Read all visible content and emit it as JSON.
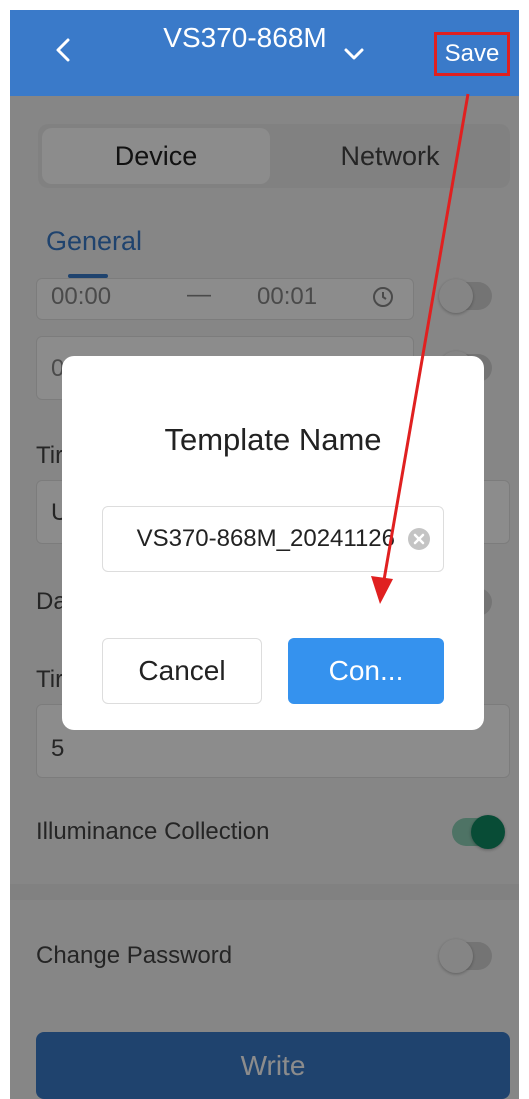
{
  "header": {
    "title": "VS370-868M",
    "save_label": "Save"
  },
  "tabs": [
    {
      "label": "Device"
    },
    {
      "label": "Network"
    }
  ],
  "subtab": {
    "label": "General"
  },
  "schedule": {
    "start": "00:00",
    "separator": "—",
    "end": "00:01",
    "row2_partial": "0"
  },
  "labels": {
    "tim_partial": "Tir",
    "u_partial": "U",
    "da_partial": "Da",
    "tim2_partial": "Tir",
    "value_5": "5",
    "illuminance": "Illuminance Collection",
    "change_password": "Change Password"
  },
  "toggles": {
    "illuminance": true,
    "change_password": false
  },
  "write_label": "Write",
  "dialog": {
    "title": "Template Name",
    "input_value": "VS370-868M_20241126",
    "cancel_label": "Cancel",
    "confirm_label": "Con..."
  },
  "colors": {
    "header": "#3a7ac9",
    "confirm": "#3592ee",
    "annotation": "#e02020",
    "toggle_on": "#0f8a63"
  }
}
